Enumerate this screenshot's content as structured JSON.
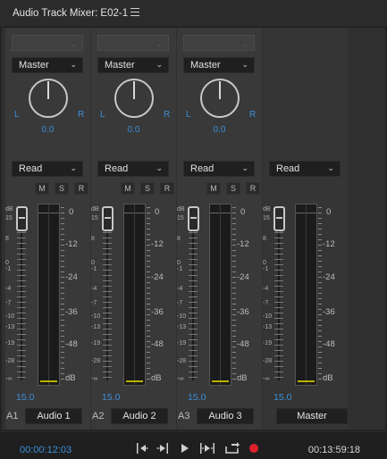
{
  "window": {
    "title": "Audio Track Mixer: E02-1"
  },
  "tracks": [
    {
      "id": "A1",
      "name": "Audio 1",
      "output": "Master",
      "automation": "Read",
      "pan": "0.0",
      "pan_l": "L",
      "pan_r": "R",
      "volume": "15.0",
      "m": "M",
      "s": "S",
      "r": "R"
    },
    {
      "id": "A2",
      "name": "Audio 2",
      "output": "Master",
      "automation": "Read",
      "pan": "0.0",
      "pan_l": "L",
      "pan_r": "R",
      "volume": "15.0",
      "m": "M",
      "s": "S",
      "r": "R"
    },
    {
      "id": "A3",
      "name": "Audio 3",
      "output": "Master",
      "automation": "Read",
      "pan": "0.0",
      "pan_l": "L",
      "pan_r": "R",
      "volume": "15.0",
      "m": "M",
      "s": "S",
      "r": "R"
    }
  ],
  "master": {
    "name": "Master",
    "automation": "Read",
    "volume": "15.0"
  },
  "fader_scale": [
    "dB",
    "15",
    "8",
    "0",
    "-1",
    "-4",
    "-7",
    "-10",
    "-13",
    "-19",
    "-28",
    "-∞"
  ],
  "meter_scale": [
    "0",
    "-12",
    "-24",
    "-36",
    "-48",
    "dB"
  ],
  "transport": {
    "current_time": "00:00:12:03",
    "duration": "00:13:59:18"
  },
  "colors": {
    "accent": "#3b8fd8",
    "record": "#e0212b",
    "meter_floor": "#b9b200"
  }
}
